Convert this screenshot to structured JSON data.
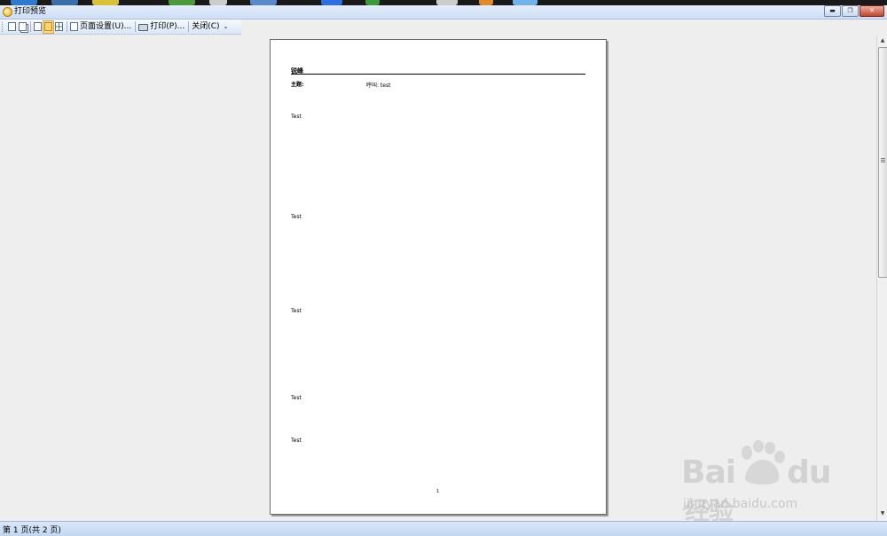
{
  "window": {
    "title": "打印预览",
    "minimize_glyph": "▬",
    "maximize_glyph": "❐",
    "close_glyph": "✕"
  },
  "toolbar": {
    "page_setup_label": "页面设置(U)...",
    "print_label": "打印(P)...",
    "close_label": "关闭(C)",
    "overflow_glyph": "⌄"
  },
  "document": {
    "title": "锐峰",
    "subject_label": "主题:",
    "sender_label": "呼叫: test",
    "entries": [
      "Test",
      "Test",
      "Test",
      "Test",
      "Test"
    ],
    "page_number": "1"
  },
  "statusbar": {
    "text": "第 1 页(共 2 页)"
  },
  "watermark": {
    "brand": "Bai",
    "brand_suffix": "du",
    "brand_cn": "经验",
    "url": "jingyan.baidu.com"
  },
  "colors": {
    "titlebar": "#cddff5",
    "toolbar": "#d9e6f6",
    "active_button": "#ffdc8c",
    "background": "#eeeeee",
    "statusbar": "#c2d6f0"
  }
}
